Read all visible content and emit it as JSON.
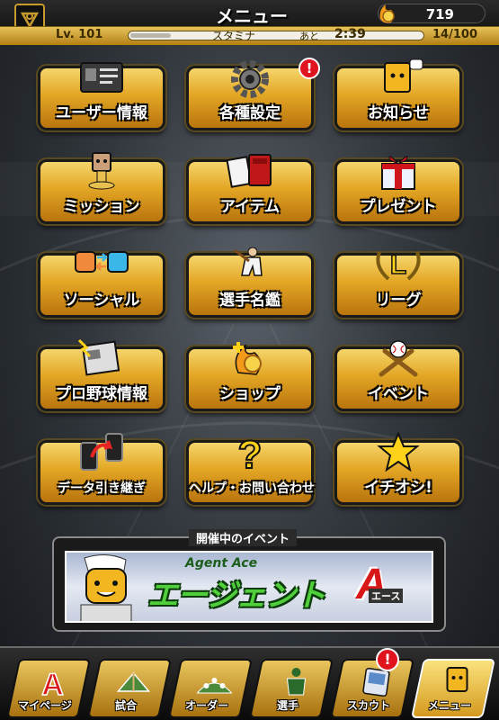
{
  "header": {
    "title": "メニュー",
    "coins": "719",
    "level": "Lv. 101",
    "stamina_label": "スタミナ",
    "time_prefix": "あと",
    "time_remaining": "2:39",
    "stamina_count": "14/100",
    "stamina_fraction": 0.14,
    "emblem_icon": "team-logo-icon",
    "coin_icon": "gold-coin-icon"
  },
  "menu": {
    "items": [
      {
        "label": "ユーザー情報",
        "icon": "id-card-icon",
        "badge": ""
      },
      {
        "label": "各種設定",
        "icon": "gear-icon",
        "badge": "!"
      },
      {
        "label": "お知らせ",
        "icon": "mascot-speech-icon",
        "badge": ""
      },
      {
        "label": "ミッション",
        "icon": "mascot-trophy-icon",
        "badge": ""
      },
      {
        "label": "アイテム",
        "icon": "item-book-icon",
        "badge": ""
      },
      {
        "label": "プレゼント",
        "icon": "gift-box-icon",
        "badge": ""
      },
      {
        "label": "ソーシャル",
        "icon": "friends-exchange-icon",
        "badge": ""
      },
      {
        "label": "選手名鑑",
        "icon": "player-batter-icon",
        "badge": ""
      },
      {
        "label": "リーグ",
        "icon": "league-laurel-icon",
        "badge": ""
      },
      {
        "label": "プロ野球情報",
        "icon": "newspaper-icon",
        "badge": ""
      },
      {
        "label": "ショップ",
        "icon": "shop-coin-icon",
        "badge": ""
      },
      {
        "label": "イベント",
        "icon": "baseball-bats-icon",
        "badge": ""
      },
      {
        "label": "データ引き継ぎ",
        "icon": "phone-transfer-icon",
        "badge": ""
      },
      {
        "label": "ヘルプ・お問い合わせ",
        "icon": "question-mark-icon",
        "badge": ""
      },
      {
        "label": "イチオシ!",
        "icon": "star-icon",
        "badge": ""
      }
    ],
    "icon_colors": {
      "main": "#f0b52b",
      "alert": "#e0141e"
    }
  },
  "event": {
    "section_title": "開催中のイベント",
    "banner_subtitle": "Agent Ace",
    "banner_title": "エージェント",
    "banner_letter": "A",
    "banner_ace": "エース"
  },
  "bottom_nav": {
    "tabs": [
      {
        "label": "マイページ",
        "icon": "mypage-a-icon"
      },
      {
        "label": "試合",
        "icon": "stadium-icon"
      },
      {
        "label": "オーダー",
        "icon": "lineup-field-icon"
      },
      {
        "label": "選手",
        "icon": "player-silhouette-icon"
      },
      {
        "label": "スカウト",
        "icon": "scout-card-icon"
      },
      {
        "label": "メニュー",
        "icon": "menu-mascot-icon"
      }
    ],
    "scout_badge": "!"
  }
}
